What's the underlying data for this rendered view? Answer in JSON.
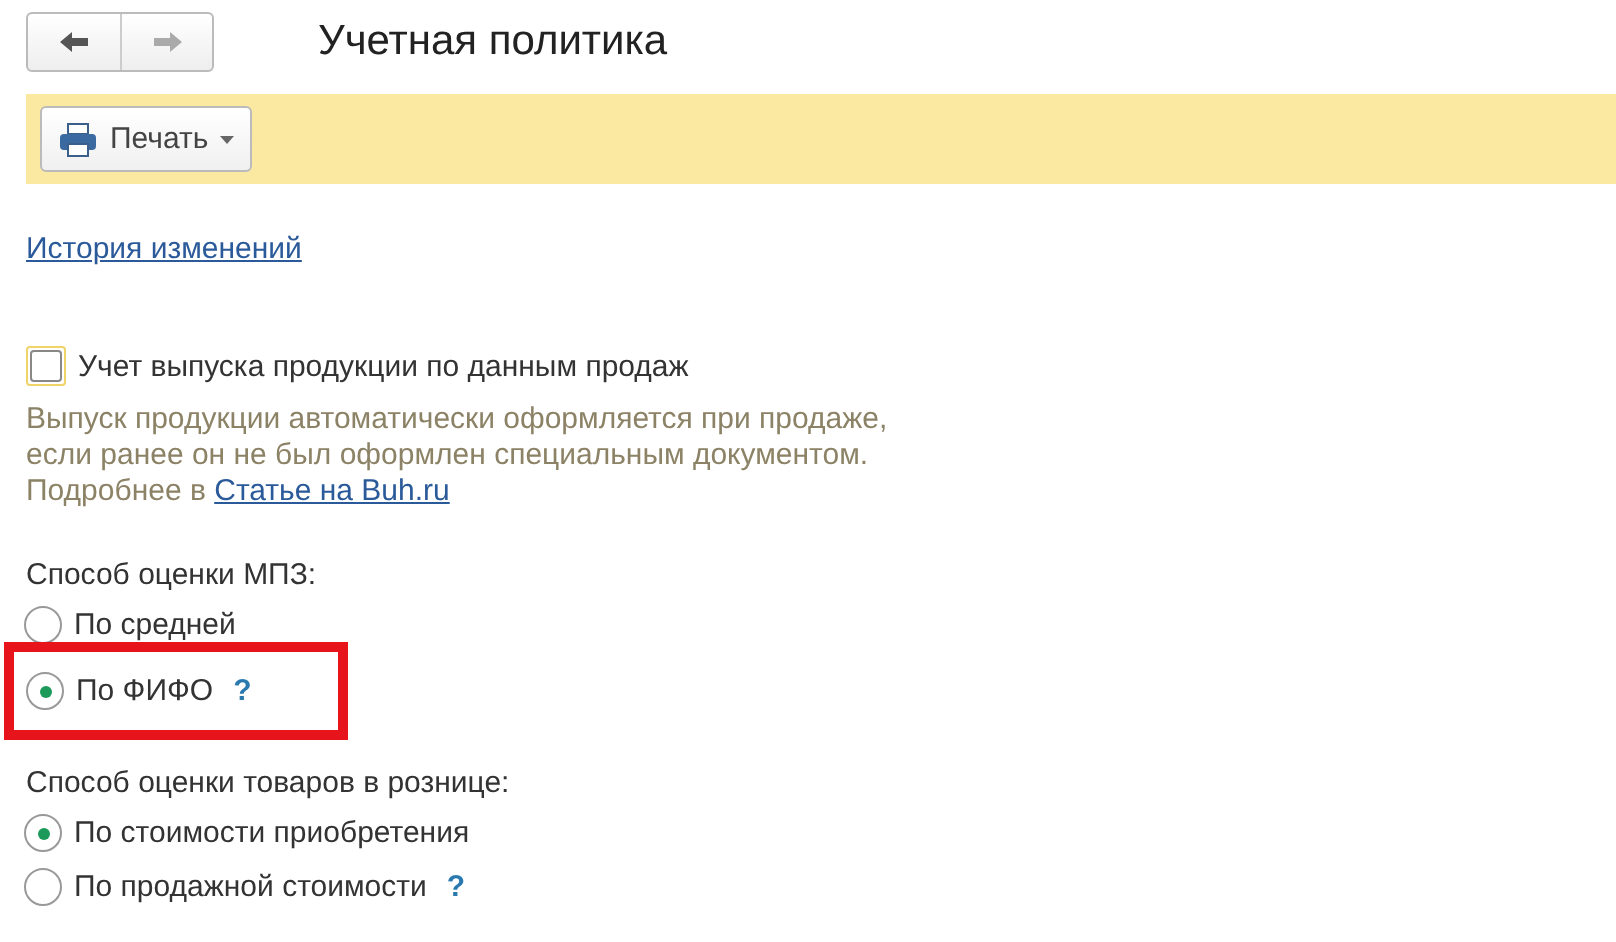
{
  "window": {
    "title": "Учетная политика"
  },
  "toolbar": {
    "print_button": "Печать"
  },
  "history_link": "История изменений",
  "output_setting": {
    "label": "Учет выпуска продукции по данным продаж",
    "checked": false,
    "hint_lines": [
      "Выпуск продукции автоматически оформляется при продаже,",
      "если ранее он не был оформлен специальным документом."
    ],
    "more_prefix": "Подробнее в",
    "more_link": "Статье на Buh.ru"
  },
  "groups": [
    {
      "label": "Способ оценки МПЗ:",
      "options": [
        {
          "label": "По средней",
          "selected": false,
          "highlighted": false
        },
        {
          "label": "По ФИФО",
          "selected": true,
          "help": "?",
          "highlighted": true
        }
      ]
    },
    {
      "label": "Способ оценки товаров в рознице:",
      "options": [
        {
          "label": "По стоимости приобретения",
          "selected": true,
          "highlighted": false
        },
        {
          "label": "По продажной стоимости",
          "selected": false,
          "help": "?",
          "highlighted": false
        }
      ]
    }
  ]
}
